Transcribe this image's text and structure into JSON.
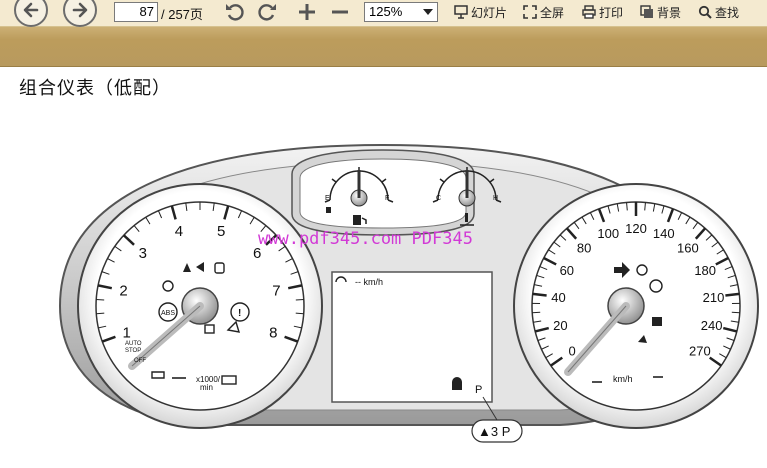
{
  "toolbar": {
    "page_current": "87",
    "page_total": "/ 257页",
    "zoom": "125%",
    "slideshow_label": "幻灯片",
    "fullscreen_label": "全屏",
    "print_label": "打印",
    "background_label": "背景",
    "find_label": "查找"
  },
  "document": {
    "title": "组合仪表（低配）"
  },
  "figure": {
    "watermark": "www.pdf345.com PDF345",
    "tach_ticks": [
      "1",
      "2",
      "3",
      "4",
      "5",
      "6",
      "7",
      "8"
    ],
    "tach_unit": "x1000/",
    "tach_unit2": "min",
    "auto_stop_1": "AUTO",
    "auto_stop_2": "STOP",
    "auto_stop_3": "OFF",
    "abs_label": "ABS",
    "speed_ticks": [
      "0",
      "20",
      "40",
      "60",
      "80",
      "100",
      "120",
      "140",
      "160",
      "180",
      "210",
      "240",
      "270"
    ],
    "speed_unit": "km/h",
    "display_speed": "-- km/h",
    "display_gear": "P",
    "callout": "▲3 P",
    "fuel_e": "E",
    "fuel_f": "F",
    "temp_c": "C",
    "temp_h": "H"
  }
}
